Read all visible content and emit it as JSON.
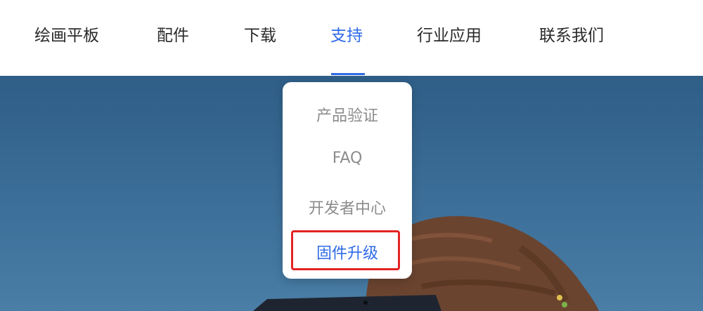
{
  "nav": {
    "items": [
      {
        "label": "绘画平板"
      },
      {
        "label": "配件"
      },
      {
        "label": "下载"
      },
      {
        "label": "支持"
      },
      {
        "label": "行业应用"
      },
      {
        "label": "联系我们"
      }
    ],
    "active": "支持"
  },
  "dropdown": {
    "items": [
      {
        "label": "产品验证"
      },
      {
        "label": "FAQ"
      },
      {
        "label": "开发者中心"
      },
      {
        "label": "固件升级"
      }
    ],
    "selected": "固件升级"
  },
  "colors": {
    "accent": "#2f6be6",
    "highlight": "#e32323",
    "hero_bg": "#3c6f99"
  }
}
